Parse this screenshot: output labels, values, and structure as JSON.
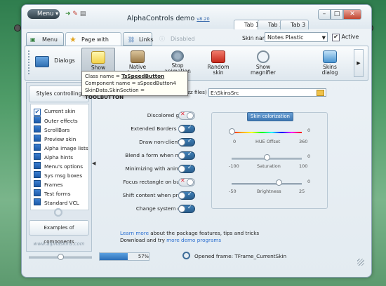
{
  "window": {
    "title": "AlphaControls demo",
    "version": "v8.20",
    "menu_label": "Menu",
    "tabs": [
      "Tab 1",
      "Tab 2",
      "Tab 3"
    ],
    "minimize": "–",
    "maximize": "□",
    "close": "✕"
  },
  "page_tabs": [
    {
      "label": "Menu"
    },
    {
      "label": "Page with toolbar"
    },
    {
      "label": "Links"
    },
    {
      "label": "Disabled tabsheet"
    }
  ],
  "skin": {
    "label": "Skin name:",
    "value": "Notes Plastic",
    "active_label": "Active",
    "active_checked": true
  },
  "toolbar": {
    "dialogs": "Dialogs",
    "show_hints": "Show\nhints",
    "native_borders": "Native\nborders",
    "stop_animation": "Stop\nanimation",
    "random_skin": "Random\nskin",
    "show_magnifier": "Show\nmagnifier",
    "skins_dialog": "Skins\ndialog"
  },
  "tooltip": {
    "line1_prefix": "Class name = ",
    "line1_value": "TsSpeedButton",
    "line2": "Component name = sSpeedButton4",
    "line3_prefix": "SkinData.SkinSection = ",
    "line3_value": "TOOLBUTTON"
  },
  "path": {
    "label": "zz files)",
    "value": "E:\\SkinsSrc"
  },
  "sidebar": {
    "header": "Styles controlling",
    "items": [
      "Current skin",
      "Outer effects",
      "ScrollBars",
      "Preview skin",
      "Alpha image lists",
      "Alpha hints",
      "Menu's options",
      "Sys msg boxes",
      "Frames",
      "Test forms",
      "Standard VCL"
    ],
    "footer": "Examples of components",
    "website": "www.alphaskins.com"
  },
  "options": [
    {
      "label": "Discolored glyphs:",
      "on": false
    },
    {
      "label": "Extended Borders mode:",
      "on": true
    },
    {
      "label": "Draw non-client area:",
      "on": true
    },
    {
      "label": "Blend a form when moved:",
      "on": true
    },
    {
      "label": "Minimizing with animation:",
      "on": true
    },
    {
      "label": "Focus rectangle on buttons:",
      "on": false
    },
    {
      "label": "Shift content when pressed:",
      "on": true
    },
    {
      "label": "Change system colors:",
      "on": true
    }
  ],
  "colorization": {
    "header": "Skin colorization",
    "hue": {
      "label": "HUE Offset",
      "min": "0",
      "max": "360",
      "value": "0",
      "fraction": 0.0
    },
    "saturation": {
      "label": "Saturation",
      "min": "-100",
      "max": "100",
      "value": "0",
      "fraction": 0.5
    },
    "brightness": {
      "label": "Brightness",
      "min": "-50",
      "max": "25",
      "value": "0",
      "fraction": 0.667
    }
  },
  "links": {
    "learn_link": "Learn more",
    "learn_text": " about the package features, tips and tricks",
    "download_text": "Download and try ",
    "demo_link": "more demo programs"
  },
  "status": {
    "progress_text": "57%",
    "progress_fraction": 0.57,
    "slider_fraction": 0.5,
    "frame_text": "Opened frame: TFrame_CurrentSkin"
  },
  "colors": {
    "accent": "#3d85c6",
    "link": "#2a6fd1",
    "toggle_on": "#3f7fb6"
  }
}
